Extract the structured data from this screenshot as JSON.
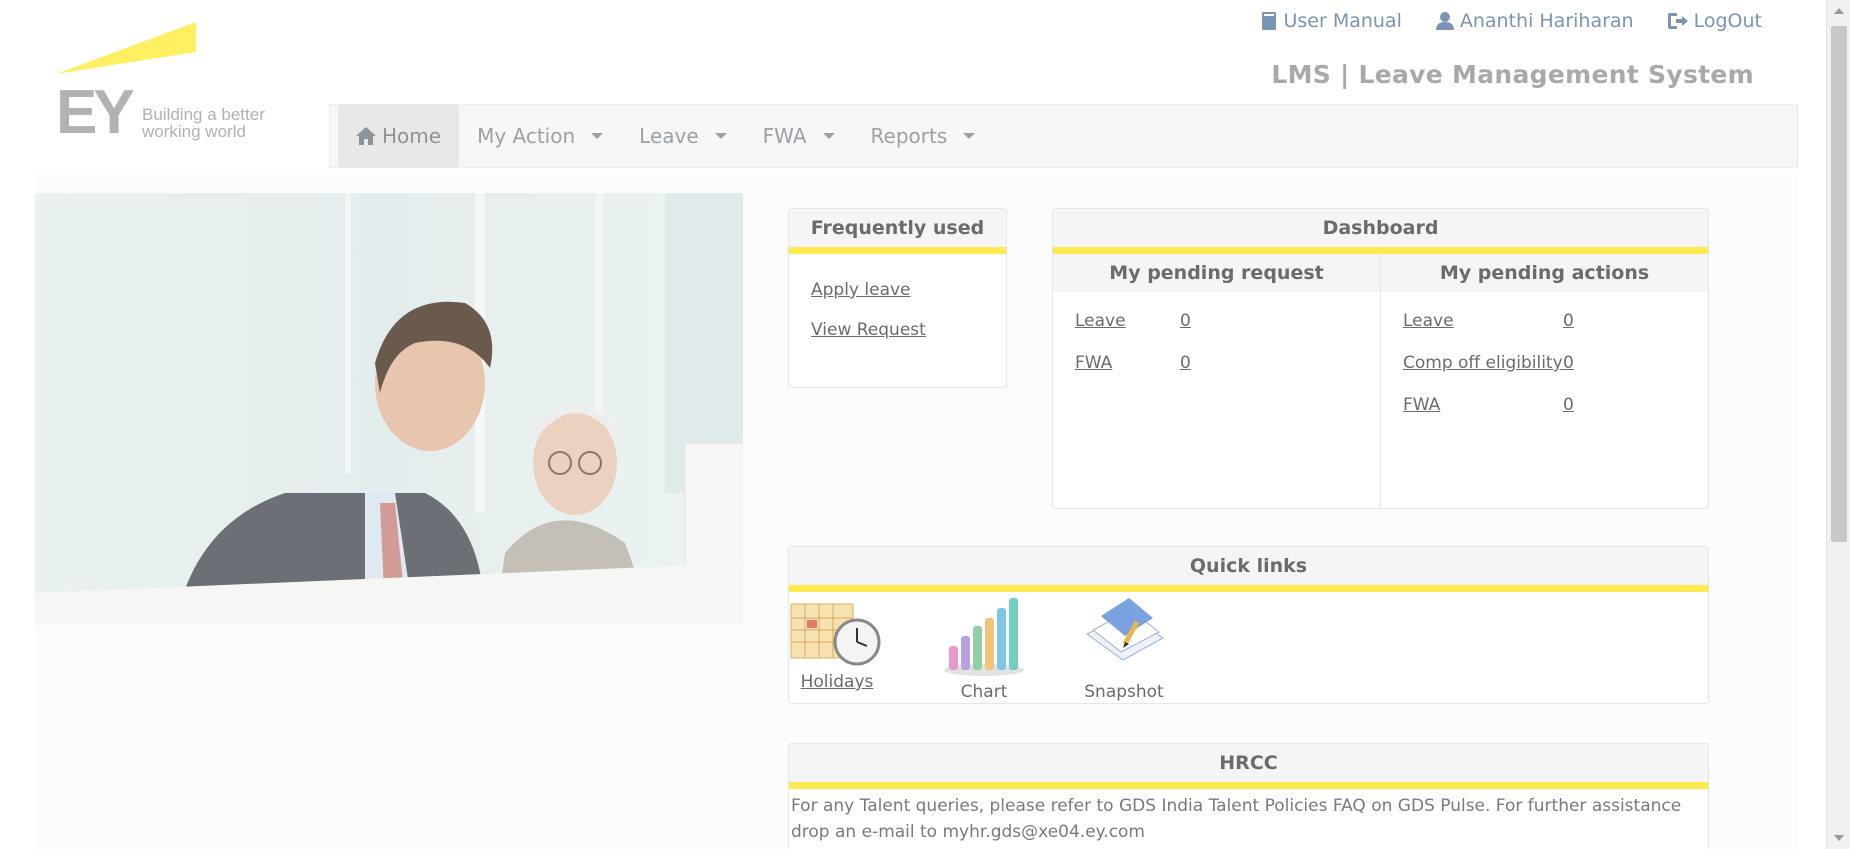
{
  "header": {
    "user_manual": "User Manual",
    "user_name": "Ananthi Hariharan",
    "logout": "LogOut",
    "app_title": "LMS | Leave Management System"
  },
  "logo": {
    "mark": "EY",
    "tagline_1": "Building a better",
    "tagline_2": "working world"
  },
  "nav": {
    "items": [
      {
        "label": "Home",
        "active": true
      },
      {
        "label": "My Action"
      },
      {
        "label": "Leave"
      },
      {
        "label": "FWA"
      },
      {
        "label": "Reports"
      }
    ]
  },
  "frequently_used": {
    "title": "Frequently used",
    "links": [
      "Apply leave",
      "View Request"
    ]
  },
  "dashboard": {
    "title": "Dashboard",
    "pending_request": {
      "title": "My pending request",
      "rows": [
        {
          "label": "Leave",
          "value": "0"
        },
        {
          "label": "FWA",
          "value": "0"
        }
      ]
    },
    "pending_actions": {
      "title": "My pending actions",
      "rows": [
        {
          "label": "Leave",
          "value": "0"
        },
        {
          "label": "Comp off eligibility",
          "value": "0"
        },
        {
          "label": "FWA",
          "value": "0"
        }
      ]
    }
  },
  "quick_links": {
    "title": "Quick links",
    "items": [
      {
        "label": "Holidays",
        "icon": "calendar-clock-icon"
      },
      {
        "label": "Chart",
        "icon": "bar-chart-icon"
      },
      {
        "label": "Snapshot",
        "icon": "snapshot-icon"
      }
    ]
  },
  "hrcc": {
    "title": "HRCC",
    "text_1": "For any Talent queries, please refer to GDS India Talent Policies FAQ on GDS Pulse. For further assistance",
    "text_2": "drop an e-mail to myhr.gds@xe04.ey.com"
  },
  "colors": {
    "accent_yellow": "#ffea4f",
    "link_blue": "#7b93b4"
  }
}
